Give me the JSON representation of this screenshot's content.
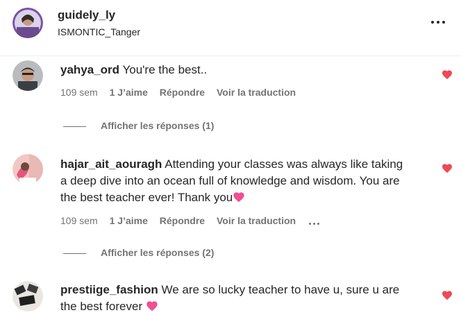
{
  "post": {
    "username": "guidely_ly",
    "location": "ISMONTIC_Tanger",
    "more_icon": "more-horizontal-icon"
  },
  "comments": [
    {
      "username": "yahya_ord",
      "text": "You're the best..",
      "age": "109 sem",
      "likes": "1 J’aime",
      "reply_label": "Répondre",
      "translate_label": "Voir la traduction",
      "replies_label": "Afficher les réponses (1)",
      "heart_icon": "heart-filled-icon",
      "heart_color": "#ed4956"
    },
    {
      "username": "hajar_ait_aouragh",
      "text": "Attending your classes was always like taking a deep dive into an ocean full of knowledge and wisdom. You are the best teacher ever! Thank you",
      "emoji": "pink-heart-emoji",
      "age": "109 sem",
      "likes": "1 J’aime",
      "reply_label": "Répondre",
      "translate_label": "Voir la traduction",
      "options_icon": "more-horizontal-icon",
      "replies_label": "Afficher les réponses (2)",
      "heart_icon": "heart-filled-icon",
      "heart_color": "#ed4956"
    },
    {
      "username": "prestiige_fashion",
      "text": "We are so lucky teacher to have u, sure u are the best forever",
      "emoji": "pink-heart-emoji",
      "heart_icon": "heart-filled-icon",
      "heart_color": "#ed4956"
    }
  ]
}
